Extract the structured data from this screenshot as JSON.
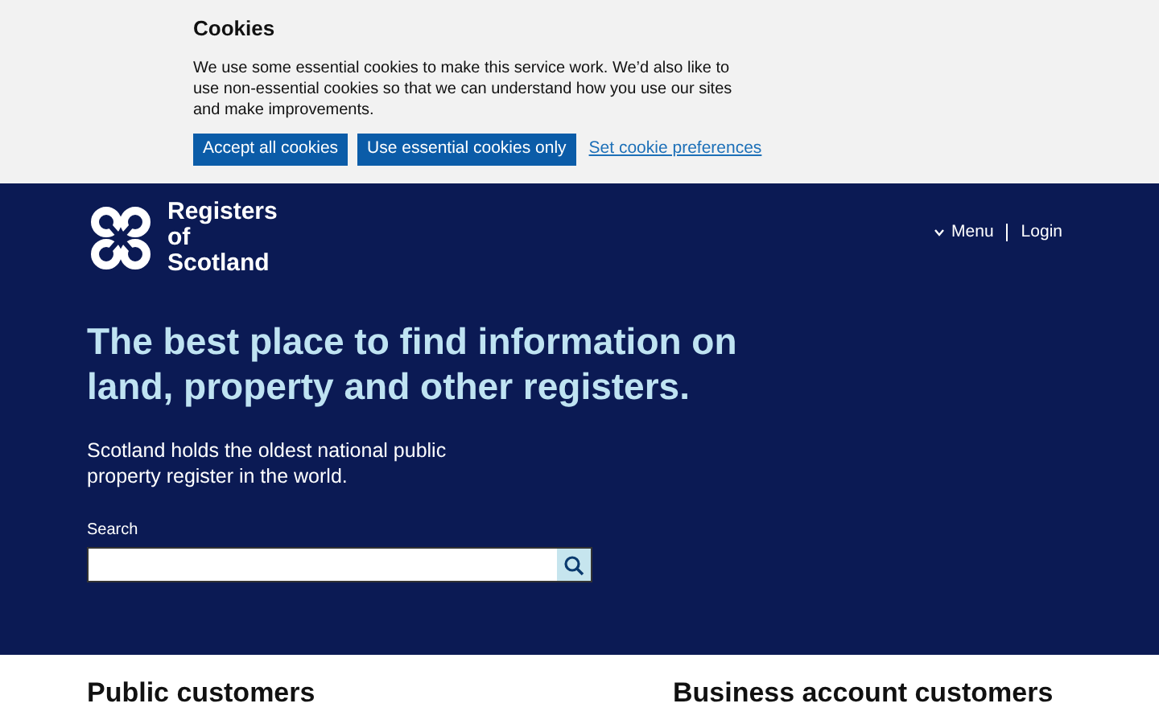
{
  "cookie_banner": {
    "title": "Cookies",
    "text": "We use some essential cookies to make this service work. We’d also like to use non-essential cookies so that we can understand how you use our sites and make improvements.",
    "buttons": [
      "Accept all cookies",
      "Use essential cookies only"
    ],
    "link": "Set cookie preferences"
  },
  "header": {
    "logo": "Registers of Scotland",
    "nav": [
      {
        "label": "Menu",
        "kind": "dropdown"
      },
      {
        "label": "Login",
        "kind": "link"
      }
    ]
  },
  "hero": {
    "heading": "The best place to find information on land, property and other registers.",
    "text": "Scotland holds the oldest national public property register in the world.",
    "search": {
      "label": "Search"
    }
  },
  "sections": [
    "Public customers",
    "Business account customers"
  ]
}
